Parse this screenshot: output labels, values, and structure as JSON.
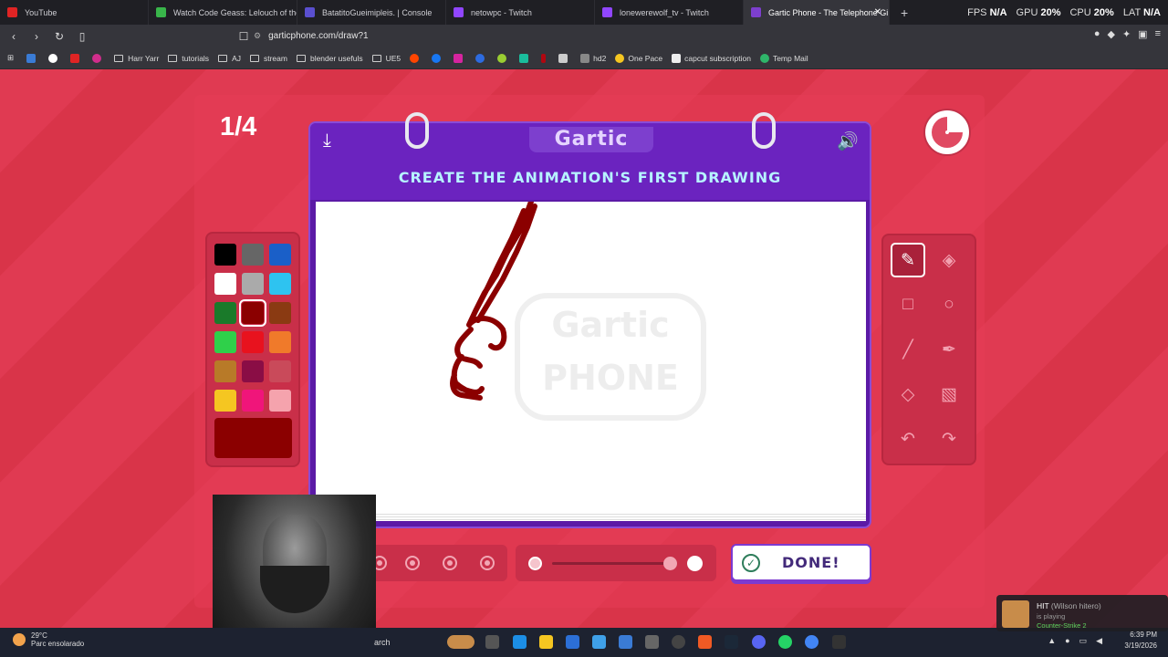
{
  "browser": {
    "tabs": [
      {
        "title": "YouTube",
        "color": "#e02424"
      },
      {
        "title": "Watch Code Geass: Lelouch of the Re",
        "color": "#39b54a"
      },
      {
        "title": "BatatitoGueimipleis. | Console",
        "color": "#5a4fcf"
      },
      {
        "title": "netowpc - Twitch",
        "color": "#9146ff"
      },
      {
        "title": "lonewerewolf_tv - Twitch",
        "color": "#9146ff"
      },
      {
        "title": "Gartic Phone - The Telephone Gi",
        "color": "#7d3fce",
        "active": true
      }
    ],
    "new_tab": "+",
    "close_glyph": "✕",
    "perf": {
      "fps_label": "FPS",
      "fps_value": "N/A",
      "gpu_label": "GPU",
      "gpu_value": "20%",
      "cpu_label": "CPU",
      "cpu_value": "20%",
      "lat_label": "LAT",
      "lat_value": "N/A"
    },
    "url": "garticphone.com/draw?1",
    "bookmarks": [
      "Harr Yarr",
      "tutorials",
      "AJ",
      "stream",
      "blender usefuls",
      "UE5",
      "hd2",
      "One Pace",
      "capcut subscription",
      "Temp Mail"
    ]
  },
  "game": {
    "round": "1/4",
    "logo": "Gartic",
    "instruction": "CREATE THE ANIMATION'S FIRST DRAWING",
    "watermark_line1": "Gartic",
    "watermark_line2": "PHONE",
    "done_label": "DONE!",
    "current_color": "#8b0000",
    "palette": [
      [
        "#000000",
        "#666666",
        "#1a5fc8"
      ],
      [
        "#ffffff",
        "#aaaaaa",
        "#2ec3f0"
      ],
      [
        "#1a7a2a",
        "#8b0000",
        "#8a3a12"
      ],
      [
        "#2fd04a",
        "#e8121e",
        "#f07a2a"
      ],
      [
        "#b87a28",
        "#8a0d45",
        "#c94a5a"
      ],
      [
        "#f5c621",
        "#f0157a",
        "#f5a3ad"
      ]
    ],
    "selected_swatch": [
      2,
      1
    ],
    "tools": [
      "pencil",
      "eraser",
      "rectangle",
      "ellipse",
      "line",
      "eyedropper",
      "fill",
      "layer",
      "undo",
      "redo"
    ]
  },
  "taskbar": {
    "temperature": "29°C",
    "weather": "Parc ensolarado",
    "search": "arch",
    "time": "6:39 PM",
    "date": "3/19/2026"
  },
  "notification": {
    "title": "HIT",
    "user": "(Wilson hitero)",
    "status": "is playing",
    "game": "Counter-Strike 2"
  }
}
